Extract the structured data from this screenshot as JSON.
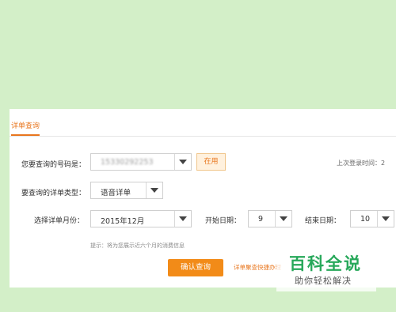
{
  "tab": {
    "label": "详单查询"
  },
  "form": {
    "number_label": "您要查询的号码是：",
    "number_value": "15330292253",
    "number_tag": "在用",
    "last_login": "上次登录时间：2",
    "type_label": "要查询的详单类型：",
    "type_value": "语音详单",
    "month_label": "选择详单月份：",
    "month_value": "2015年12月",
    "start_label": "开始日期：",
    "start_value": "9",
    "end_label": "结束日期：",
    "end_value": "10",
    "hint": "提示：将为您展示近六个月的消费信息",
    "confirm_label": "确认查询",
    "quick_link": "详单聚查快捷办理"
  },
  "watermark": {
    "title": "百科全说",
    "subtitle": "助你轻松解决"
  },
  "colors": {
    "accent": "#e8761e",
    "button": "#f28b18",
    "background": "#d3efc8",
    "watermark_green": "#27a85a"
  }
}
